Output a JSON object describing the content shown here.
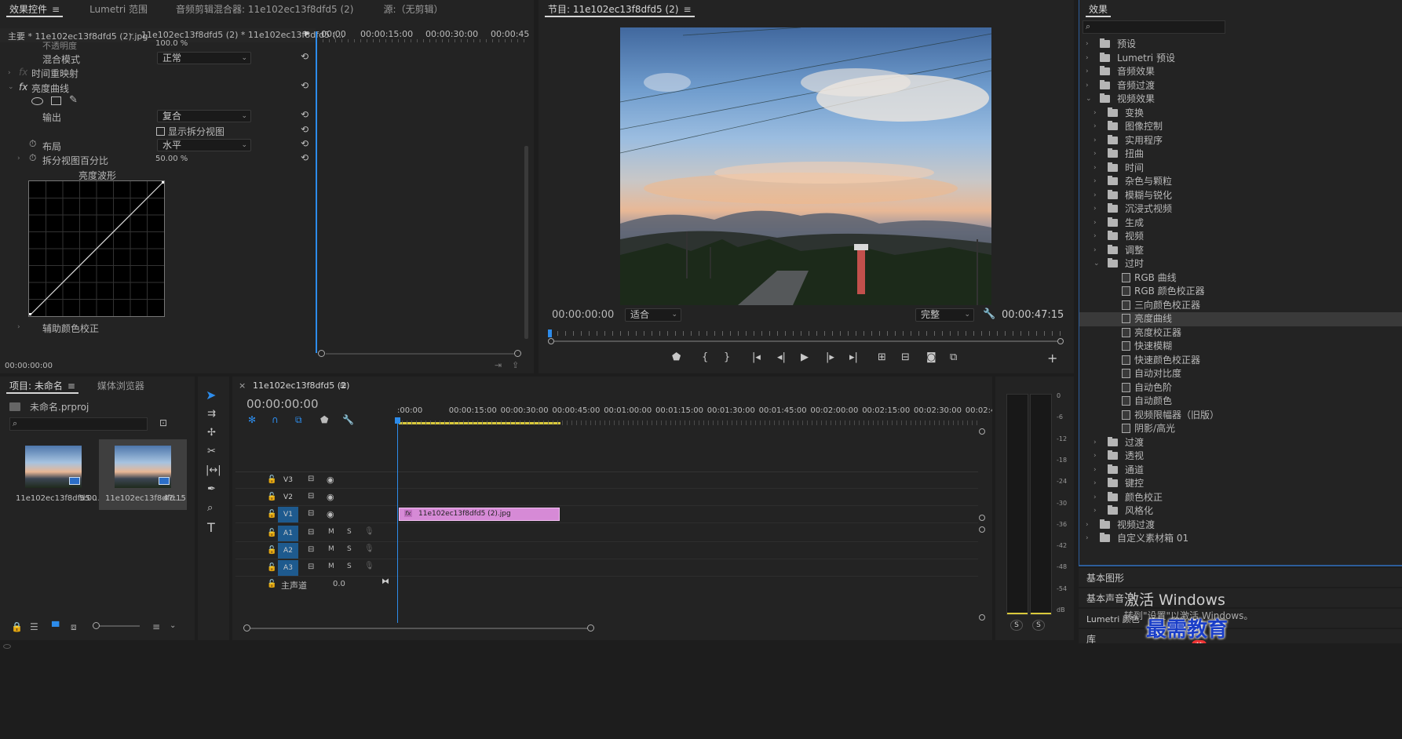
{
  "effect_controls": {
    "tabs": [
      "效果控件",
      "Lumetri 范围",
      "音频剪辑混合器: 11e102ec13f8dfd5 (2)",
      "源:（无剪辑）"
    ],
    "menu_glyph": "≡",
    "source_label": "主要 * 11e102ec13f8dfd5 (2).jpg",
    "sequence_label": "11e102ec13f8dfd5 (2) * 11e102ec13f8dfd5 (...",
    "mini_ruler": [
      "00:00",
      "00:00:15:00",
      "00:00:30:00",
      "00:00:45"
    ],
    "opacity_label": "不透明度",
    "opacity_value": "100.0 %",
    "blend_label": "混合模式",
    "blend_value": "正常",
    "time_remap_label": "时间重映射",
    "fx_badge": "fx",
    "curve_effect_label": "亮度曲线",
    "output_label": "输出",
    "output_value": "复合",
    "split_view_label": "显示拆分视图",
    "layout_label": "布局",
    "layout_value": "水平",
    "split_pct_label": "拆分视图百分比",
    "split_pct_value": "50.00 %",
    "waveform_label": "亮度波形",
    "aux_color_label": "辅助颜色校正",
    "timecode": "00:00:00:00"
  },
  "program_monitor": {
    "title": "节目: 11e102ec13f8dfd5 (2)",
    "timecode": "00:00:00:00",
    "fit_value": "适合",
    "quality_value": "完整",
    "duration": "00:00:47:15",
    "transport_icons": [
      "marker-icon",
      "mark-in-icon",
      "mark-out-icon",
      "go-to-in-icon",
      "step-back-icon",
      "play-icon",
      "step-forward-icon",
      "go-to-out-icon",
      "insert-icon",
      "overwrite-icon",
      "export-frame-icon",
      "compare-icon",
      "add-button-icon"
    ]
  },
  "effects_panel": {
    "title": "效果",
    "items": [
      {
        "level": 0,
        "kind": "folder",
        "expanded": false,
        "label": "预设"
      },
      {
        "level": 0,
        "kind": "folder",
        "expanded": false,
        "label": "Lumetri 预设"
      },
      {
        "level": 0,
        "kind": "folder",
        "expanded": false,
        "label": "音频效果"
      },
      {
        "level": 0,
        "kind": "folder",
        "expanded": false,
        "label": "音频过渡"
      },
      {
        "level": 0,
        "kind": "folder",
        "expanded": true,
        "label": "视频效果"
      },
      {
        "level": 1,
        "kind": "folder",
        "expanded": false,
        "label": "变换"
      },
      {
        "level": 1,
        "kind": "folder",
        "expanded": false,
        "label": "图像控制"
      },
      {
        "level": 1,
        "kind": "folder",
        "expanded": false,
        "label": "实用程序"
      },
      {
        "level": 1,
        "kind": "folder",
        "expanded": false,
        "label": "扭曲"
      },
      {
        "level": 1,
        "kind": "folder",
        "expanded": false,
        "label": "时间"
      },
      {
        "level": 1,
        "kind": "folder",
        "expanded": false,
        "label": "杂色与颗粒"
      },
      {
        "level": 1,
        "kind": "folder",
        "expanded": false,
        "label": "模糊与锐化"
      },
      {
        "level": 1,
        "kind": "folder",
        "expanded": false,
        "label": "沉浸式视频"
      },
      {
        "level": 1,
        "kind": "folder",
        "expanded": false,
        "label": "生成"
      },
      {
        "level": 1,
        "kind": "folder",
        "expanded": false,
        "label": "视频"
      },
      {
        "level": 1,
        "kind": "folder",
        "expanded": false,
        "label": "调整"
      },
      {
        "level": 1,
        "kind": "folder",
        "expanded": true,
        "label": "过时"
      },
      {
        "level": 2,
        "kind": "effect",
        "label": "RGB 曲线"
      },
      {
        "level": 2,
        "kind": "effect",
        "label": "RGB 颜色校正器"
      },
      {
        "level": 2,
        "kind": "effect",
        "label": "三向颜色校正器"
      },
      {
        "level": 2,
        "kind": "effect",
        "label": "亮度曲线",
        "selected": true
      },
      {
        "level": 2,
        "kind": "effect",
        "label": "亮度校正器"
      },
      {
        "level": 2,
        "kind": "effect",
        "label": "快速模糊"
      },
      {
        "level": 2,
        "kind": "effect",
        "label": "快速颜色校正器"
      },
      {
        "level": 2,
        "kind": "effect",
        "label": "自动对比度"
      },
      {
        "level": 2,
        "kind": "effect",
        "label": "自动色阶"
      },
      {
        "level": 2,
        "kind": "effect",
        "label": "自动颜色"
      },
      {
        "level": 2,
        "kind": "effect",
        "label": "视频限幅器（旧版）"
      },
      {
        "level": 2,
        "kind": "effect",
        "label": "阴影/高光"
      },
      {
        "level": 1,
        "kind": "folder",
        "expanded": false,
        "label": "过渡"
      },
      {
        "level": 1,
        "kind": "folder",
        "expanded": false,
        "label": "透视"
      },
      {
        "level": 1,
        "kind": "folder",
        "expanded": false,
        "label": "通道"
      },
      {
        "level": 1,
        "kind": "folder",
        "expanded": false,
        "label": "键控"
      },
      {
        "level": 1,
        "kind": "folder",
        "expanded": false,
        "label": "颜色校正"
      },
      {
        "level": 1,
        "kind": "folder",
        "expanded": false,
        "label": "风格化"
      },
      {
        "level": 0,
        "kind": "folder",
        "expanded": false,
        "label": "视频过渡"
      },
      {
        "level": 0,
        "kind": "folder",
        "expanded": false,
        "label": "自定义素材箱 01"
      }
    ],
    "bottom_panels": [
      "基本图形",
      "基本声音",
      "Lumetri 颜色"
    ],
    "cut_label": "库"
  },
  "watermark": {
    "line1": "激活 Windows",
    "line2": "转到\"设置\"以激活 Windows。",
    "logo": "最需教育",
    "ime": "英"
  },
  "project_panel": {
    "tabs": [
      "项目: 未命名",
      "媒体浏览器"
    ],
    "project_file": "未命名.prproj",
    "clips": [
      {
        "name": "11e102ec13f8dfd5 ...",
        "duration": "5:00"
      },
      {
        "name": "11e102ec13f8dfd...",
        "duration": "47:15"
      }
    ]
  },
  "timeline": {
    "sequence_tab": "11e102ec13f8dfd5 (2)",
    "timecode": "00:00:00:00",
    "ruler": [
      ":00:00",
      "00:00:15:00",
      "00:00:30:00",
      "00:00:45:00",
      "00:01:00:00",
      "00:01:15:00",
      "00:01:30:00",
      "00:01:45:00",
      "00:02:00:00",
      "00:02:15:00",
      "00:02:30:00",
      "00:02:45:"
    ],
    "video_tracks": [
      "V3",
      "V2",
      "V1"
    ],
    "audio_tracks": [
      "A1",
      "A2",
      "A3"
    ],
    "mute_label": "M",
    "solo_label": "S",
    "master_label": "主声道",
    "master_value": "0.0",
    "clip_name": "11e102ec13f8dfd5 (2).jpg",
    "clip_fx_badge": "fx"
  },
  "audio_meter": {
    "scale": [
      "0",
      "-6",
      "-12",
      "-18",
      "-24",
      "-30",
      "-36",
      "-42",
      "-48",
      "-54",
      "dB"
    ],
    "solo_buttons": [
      "S",
      "S"
    ]
  },
  "colors": {
    "accent": "#2d8ceb",
    "panel_bg": "#232323",
    "clip_fill": "#d68ad6"
  }
}
